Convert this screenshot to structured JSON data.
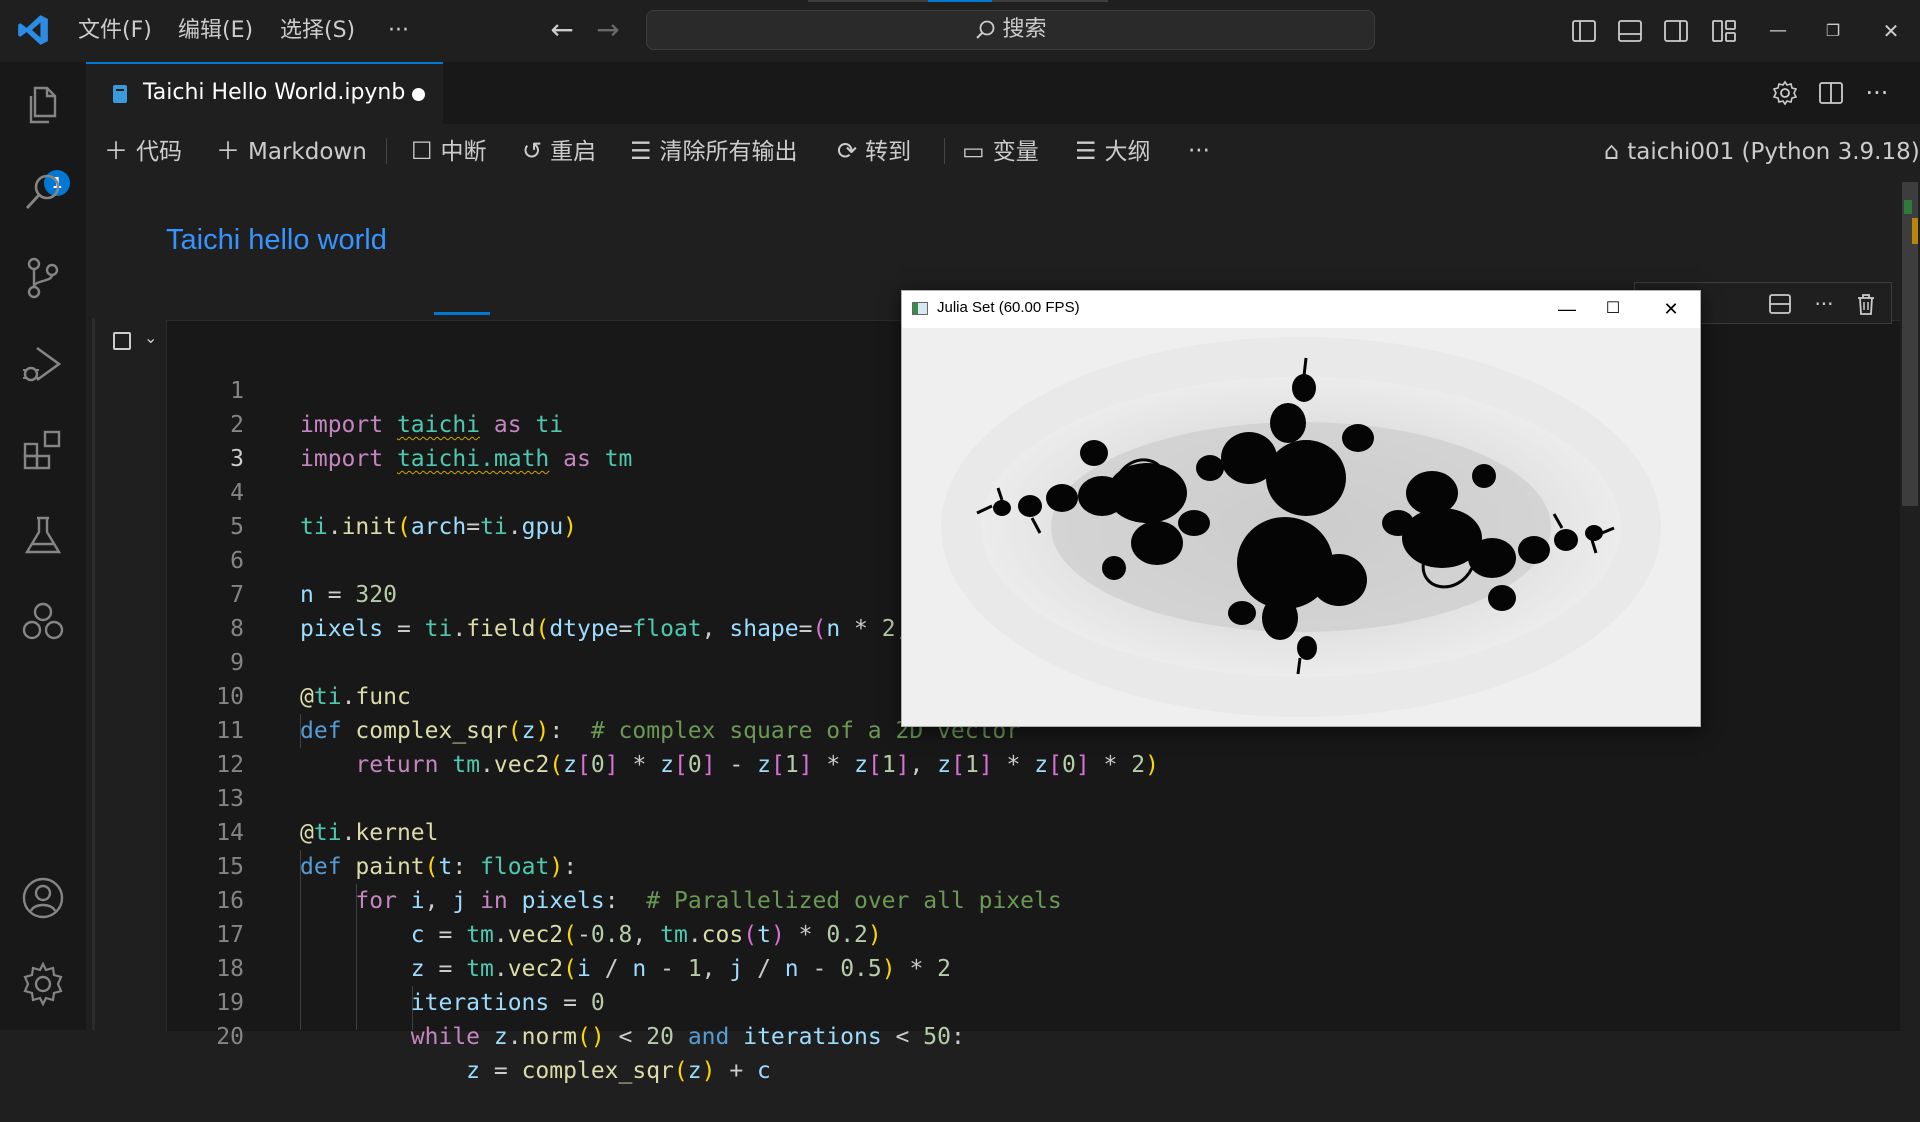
{
  "menu": {
    "file": "文件(F)",
    "edit": "编辑(E)",
    "selection": "选择(S)",
    "more": "···"
  },
  "search": {
    "placeholder": "搜索"
  },
  "activity": {
    "explorer_badge": "1"
  },
  "tab": {
    "title": "Taichi Hello World.ipynb"
  },
  "toolbar": {
    "code": "代码",
    "markdown": "Markdown",
    "interrupt": "中断",
    "restart": "重启",
    "clear_outputs": "清除所有输出",
    "goto": "转到",
    "variables": "变量",
    "outline": "大纲",
    "more": "···",
    "kernel": "taichi001 (Python 3.9.18)"
  },
  "markdown_cell": {
    "heading": "Taichi hello world"
  },
  "code_cell": {
    "line_numbers": [
      "1",
      "2",
      "3",
      "4",
      "5",
      "6",
      "7",
      "8",
      "9",
      "10",
      "11",
      "12",
      "13",
      "14",
      "15",
      "16",
      "17",
      "18",
      "19",
      "20"
    ],
    "active_line": 3
  },
  "julia_window": {
    "title": "Julia Set (60.00 FPS)",
    "minimize": "—",
    "maximize": "☐",
    "close": "✕"
  },
  "colors": {
    "accent": "#0078d4",
    "heading": "#3794ff",
    "background": "#1f1f1f",
    "cell_background": "#181818"
  },
  "icons": [
    "vscode-logo",
    "files-icon",
    "search-icon",
    "source-control-icon",
    "run-debug-icon",
    "extensions-icon",
    "testing-icon",
    "remote-icon",
    "account-icon",
    "settings-gear-icon"
  ]
}
